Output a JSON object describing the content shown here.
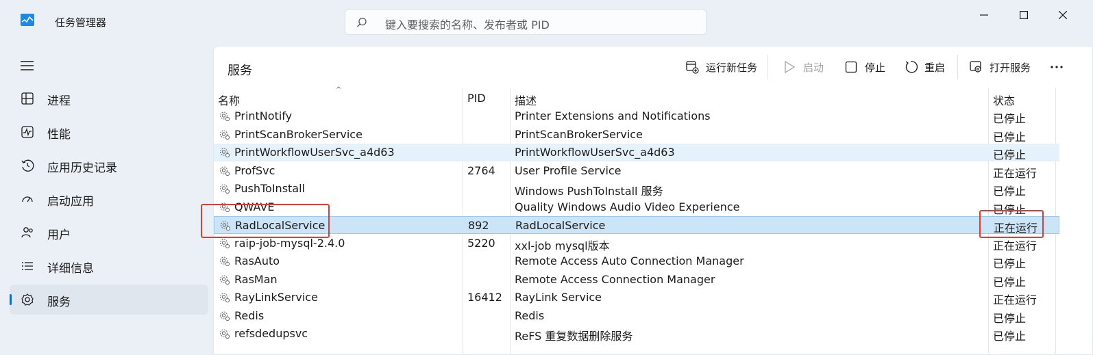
{
  "app": {
    "title": "任务管理器"
  },
  "search": {
    "placeholder": "键入要搜索的名称、发布者或 PID"
  },
  "sidebar": {
    "items": [
      {
        "label": "进程",
        "icon": "processes-icon"
      },
      {
        "label": "性能",
        "icon": "performance-icon"
      },
      {
        "label": "应用历史记录",
        "icon": "history-icon"
      },
      {
        "label": "启动应用",
        "icon": "startup-icon"
      },
      {
        "label": "用户",
        "icon": "users-icon"
      },
      {
        "label": "详细信息",
        "icon": "details-icon"
      },
      {
        "label": "服务",
        "icon": "services-icon",
        "active": true
      }
    ]
  },
  "page": {
    "title": "服务"
  },
  "toolbar": {
    "run_new_task": "运行新任务",
    "start": "启动",
    "stop": "停止",
    "restart": "重启",
    "open_services": "打开服务"
  },
  "table": {
    "columns": {
      "name": "名称",
      "pid": "PID",
      "description": "描述",
      "status": "状态"
    },
    "rows": [
      {
        "name": "PrintNotify",
        "pid": "",
        "description": "Printer Extensions and Notifications",
        "status": "已停止"
      },
      {
        "name": "PrintScanBrokerService",
        "pid": "",
        "description": "PrintScanBrokerService",
        "status": "已停止"
      },
      {
        "name": "PrintWorkflowUserSvc_a4d63",
        "pid": "",
        "description": "PrintWorkflowUserSvc_a4d63",
        "status": "已停止"
      },
      {
        "name": "ProfSvc",
        "pid": "2764",
        "description": "User Profile Service",
        "status": "正在运行"
      },
      {
        "name": "PushToInstall",
        "pid": "",
        "description": "Windows PushToInstall 服务",
        "status": "已停止"
      },
      {
        "name": "QWAVE",
        "pid": "",
        "description": "Quality Windows Audio Video Experience",
        "status": "已停止"
      },
      {
        "name": "RadLocalService",
        "pid": "892",
        "description": "RadLocalService",
        "status": "正在运行"
      },
      {
        "name": "raip-job-mysql-2.4.0",
        "pid": "5220",
        "description": "xxl-job mysql版本",
        "status": "正在运行"
      },
      {
        "name": "RasAuto",
        "pid": "",
        "description": "Remote Access Auto Connection Manager",
        "status": "已停止"
      },
      {
        "name": "RasMan",
        "pid": "",
        "description": "Remote Access Connection Manager",
        "status": "已停止"
      },
      {
        "name": "RayLinkService",
        "pid": "16412",
        "description": "RayLink Service",
        "status": "正在运行"
      },
      {
        "name": "Redis",
        "pid": "",
        "description": "Redis",
        "status": "已停止"
      },
      {
        "name": "refsdedupsvc",
        "pid": "",
        "description": "ReFS 重复数据删除服务",
        "status": "已停止"
      }
    ]
  },
  "colors": {
    "accent": "#0f6cbd",
    "selected_row": "#cce4f7",
    "hover_row": "#e5f1fb",
    "highlight_box": "#e23b30"
  }
}
